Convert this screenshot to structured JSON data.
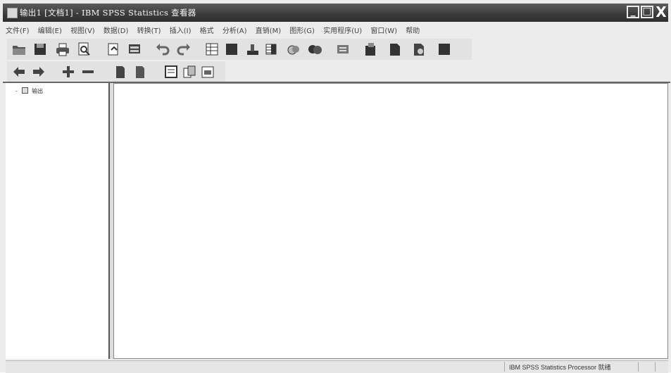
{
  "window": {
    "title": "输出1 [文档1] - IBM SPSS Statistics 查看器",
    "min_label": "_",
    "max_label": "□",
    "close_label": "X"
  },
  "menubar": {
    "items": [
      {
        "label": "文件(F)"
      },
      {
        "label": "编辑(E)"
      },
      {
        "label": "视图(V)"
      },
      {
        "label": "数据(D)"
      },
      {
        "label": "转换(T)"
      },
      {
        "label": "插入(I)"
      },
      {
        "label": "格式"
      },
      {
        "label": "分析(A)"
      },
      {
        "label": "直销(M)"
      },
      {
        "label": "图形(G)"
      },
      {
        "label": "实用程序(U)"
      },
      {
        "label": "窗口(W)"
      },
      {
        "label": "帮助"
      }
    ]
  },
  "toolbar_row1": {
    "icons": [
      "open-folder-icon",
      "save-icon",
      "print-icon",
      "print-preview-icon",
      "export-icon",
      "recall-dialog-icon",
      "undo-icon",
      "redo-icon",
      "goto-data-icon",
      "goto-case-icon",
      "variables-icon",
      "split-file-icon",
      "select-cases-icon",
      "value-labels-icon",
      "use-sets-icon",
      "designate-window-icon",
      "insert-heading-icon",
      "insert-title-icon",
      "insert-text-icon"
    ]
  },
  "toolbar_row2": {
    "icons": [
      "promote-icon",
      "demote-icon",
      "expand-icon",
      "collapse-icon",
      "show-icon",
      "hide-icon",
      "insert-chart-icon",
      "insert-page-break-icon",
      "insert-new-title-icon"
    ]
  },
  "tree": {
    "root_label": "输出",
    "root_expander": "-"
  },
  "statusbar": {
    "processor_status": "IBM SPSS Statistics Processor 就绪"
  }
}
